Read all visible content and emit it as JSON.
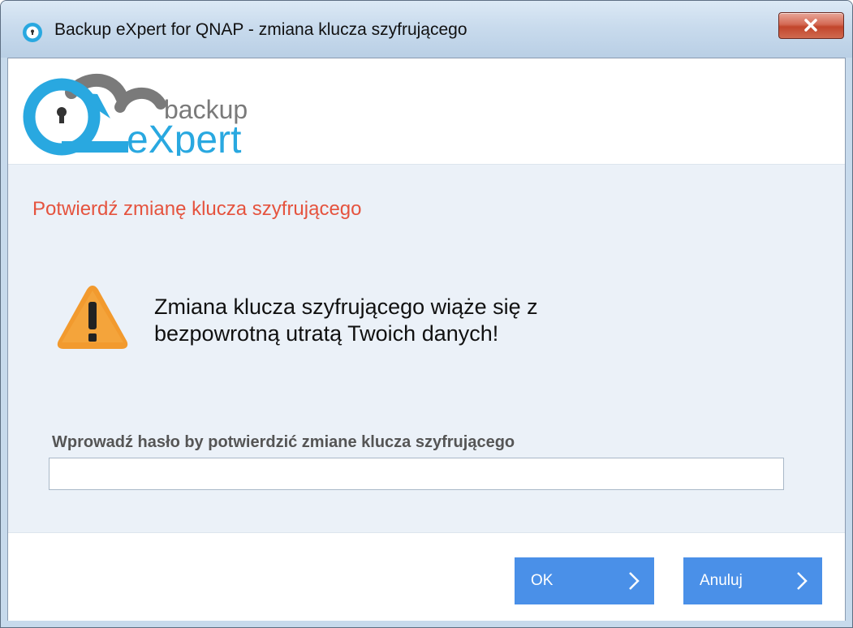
{
  "window": {
    "title": "Backup eXpert for QNAP - zmiana klucza szyfrującego"
  },
  "logo": {
    "line1": "backup",
    "line2": "eXpert"
  },
  "dialog": {
    "headline": "Potwierdź zmianę klucza szyfrującego",
    "warning_line1": "Zmiana klucza szyfrującego wiąże się z",
    "warning_line2": "bezpowrotną utratą Twoich danych!",
    "password_label": "Wprowadź hasło by potwierdzić zmiane klucza szyfrującego",
    "password_value": ""
  },
  "buttons": {
    "ok_label": "OK",
    "cancel_label": "Anuluj"
  },
  "icons": {
    "app": "cloud-lock-icon",
    "close": "close-icon",
    "warning": "warning-icon",
    "chevron": "chevron-right-icon"
  },
  "colors": {
    "accent": "#4a90e8",
    "headline": "#e5533e",
    "logo_blue": "#29a8e0",
    "logo_gray": "#7a7a7a"
  }
}
